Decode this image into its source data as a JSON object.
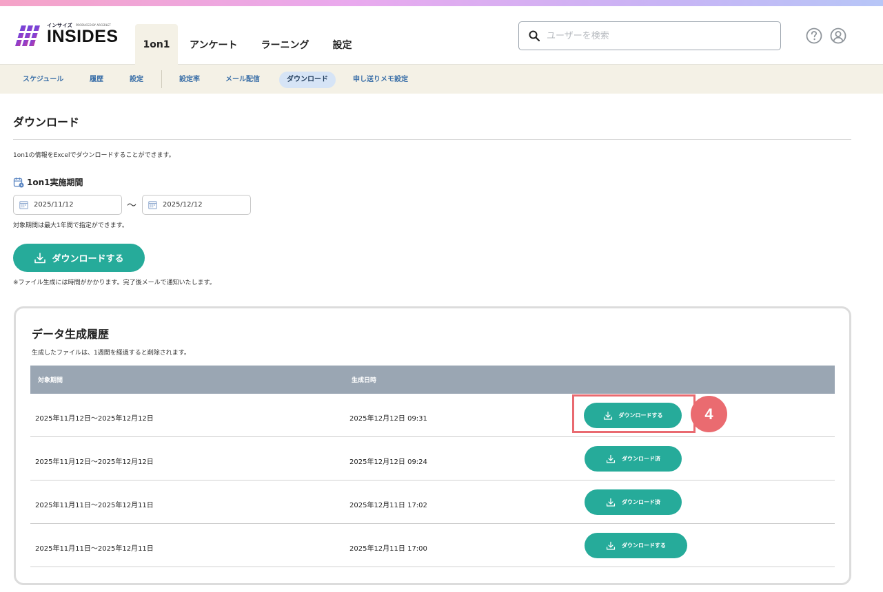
{
  "header": {
    "logo_kana": "インサイズ",
    "logo_produced": "PRODUCED BY ARCERLET",
    "logo_word": "INSIDES",
    "tabs": [
      {
        "label": "1on1"
      },
      {
        "label": "アンケート"
      },
      {
        "label": "ラーニング"
      },
      {
        "label": "設定"
      }
    ],
    "search_placeholder": "ユーザーを検索",
    "help_icon": "help-circle-icon",
    "user_icon": "user-account-icon"
  },
  "subnav": {
    "items": [
      {
        "label": "スケジュール"
      },
      {
        "label": "履歴"
      },
      {
        "label": "設定"
      },
      {
        "label": "設定率"
      },
      {
        "label": "メール配信"
      },
      {
        "label": "ダウンロード"
      },
      {
        "label": "申し送りメモ設定"
      }
    ]
  },
  "page": {
    "title": "ダウンロード",
    "description": "1on1の情報をExcelでダウンロードすることができます。",
    "period_label": "1on1実施期間",
    "start_date": "2025/11/12",
    "end_date": "2025/12/12",
    "separator": "〜",
    "period_note": "対象期間は最大1年間で指定ができます。",
    "download_button": "ダウンロードする",
    "generation_note": "※ファイル生成には時間がかかります。完了後メールで通知いたします。"
  },
  "history": {
    "title": "データ生成履歴",
    "note": "生成したファイルは、1週間を経過すると削除されます。",
    "columns": {
      "period": "対象期間",
      "created": "生成日時"
    },
    "rows": [
      {
        "period": "2025年11月12日〜2025年12月12日",
        "created": "2025年12月12日 09:31",
        "action": "ダウンロードする"
      },
      {
        "period": "2025年11月12日〜2025年12月12日",
        "created": "2025年12月12日 09:24",
        "action": "ダウンロード済"
      },
      {
        "period": "2025年11月11日〜2025年12月11日",
        "created": "2025年12月11日 17:02",
        "action": "ダウンロード済"
      },
      {
        "period": "2025年11月11日〜2025年12月11日",
        "created": "2025年12月11日 17:00",
        "action": "ダウンロードする"
      }
    ]
  },
  "annotation": {
    "step": "4",
    "color": "#ea6b70"
  },
  "colors": {
    "accent": "#26ab9a",
    "subnav_bg": "#f4f1e6",
    "table_header": "#9aa6b3",
    "link": "#3a6fa8"
  }
}
